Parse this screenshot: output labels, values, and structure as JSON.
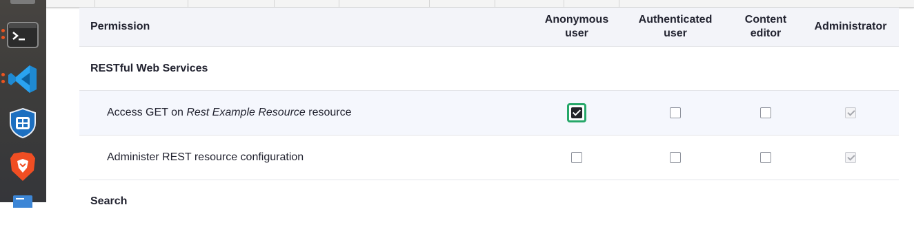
{
  "dock": {
    "items": [
      {
        "name": "terminal-icon"
      },
      {
        "name": "vscode-icon"
      },
      {
        "name": "shield-app-icon"
      },
      {
        "name": "brave-browser-icon"
      },
      {
        "name": "document-app-icon"
      }
    ]
  },
  "table": {
    "header": {
      "permission": "Permission",
      "columns": [
        {
          "line1": "Anonymous",
          "line2": "user"
        },
        {
          "line1": "Authenticated",
          "line2": "user"
        },
        {
          "line1": "Content",
          "line2": "editor"
        },
        {
          "line1": "Administrator",
          "line2": ""
        }
      ]
    },
    "groups": [
      {
        "title": "RESTful Web Services",
        "permissions": [
          {
            "label_prefix": "Access GET on ",
            "label_em": "Rest Example Resource",
            "label_suffix": " resource",
            "checked": [
              true,
              false,
              false,
              true
            ],
            "disabled": [
              false,
              false,
              false,
              true
            ],
            "focused_column": 0
          },
          {
            "label_prefix": "Administer REST resource configuration",
            "label_em": "",
            "label_suffix": "",
            "checked": [
              false,
              false,
              false,
              true
            ],
            "disabled": [
              false,
              false,
              false,
              true
            ]
          }
        ]
      },
      {
        "title": "Search"
      }
    ]
  },
  "colors": {
    "focus_ring": "#26a769",
    "header_bg": "#f3f4f9",
    "highlight_row_bg": "#f5f7fd",
    "dock_accent": "#e95420"
  }
}
